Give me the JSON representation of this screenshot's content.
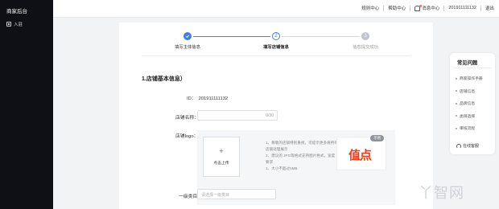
{
  "sidebar": {
    "brand": "商家后台",
    "nav": [
      {
        "label": "入驻",
        "icon": "settle-in-icon"
      }
    ]
  },
  "topbar": {
    "links": [
      "规则中心",
      "帮助中心",
      "消息中心",
      "201911111132",
      "退出"
    ],
    "bell_icon": "bell-icon"
  },
  "steps": [
    {
      "index": "1",
      "label": "填写主体信息",
      "state": "done",
      "icon": "check-icon"
    },
    {
      "index": "2",
      "label": "填写店铺信息",
      "state": "active"
    },
    {
      "index": "3",
      "label": "信息提交成功",
      "state": "pending"
    }
  ],
  "form": {
    "section_title": "1.店铺基本信息）",
    "id_label": "ID：",
    "id_value": "201911111132",
    "shop_name_label": "店铺名称：",
    "shop_name_value": "",
    "shop_name_counter": "0/30",
    "logo_label": "店铺logo：",
    "upload_plus": "+",
    "upload_text": "点击上传",
    "tips": [
      "1、尊敬的店铺特别重视，可提示更多将所有店铺处理展示",
      "2、建议的 JPG等格式支持图片格式，宽度要求",
      "1、大小不超过5MB"
    ],
    "example_badge": "示例",
    "example_logo_text": "值点",
    "category_label": "一级类目：",
    "category_placeholder": "请选择一级类目"
  },
  "faq": {
    "title": "常见问题",
    "items": [
      "商家操作手册",
      "店铺信息",
      "品牌信息",
      "类目选择",
      "审核流程"
    ],
    "online_label": "在线客服",
    "online_icon": "headset-icon"
  },
  "watermark": "丫智网",
  "colors": {
    "accent": "#3d7eea",
    "sidebar_bg": "#0e1015",
    "logo_red": "#e8401d"
  }
}
